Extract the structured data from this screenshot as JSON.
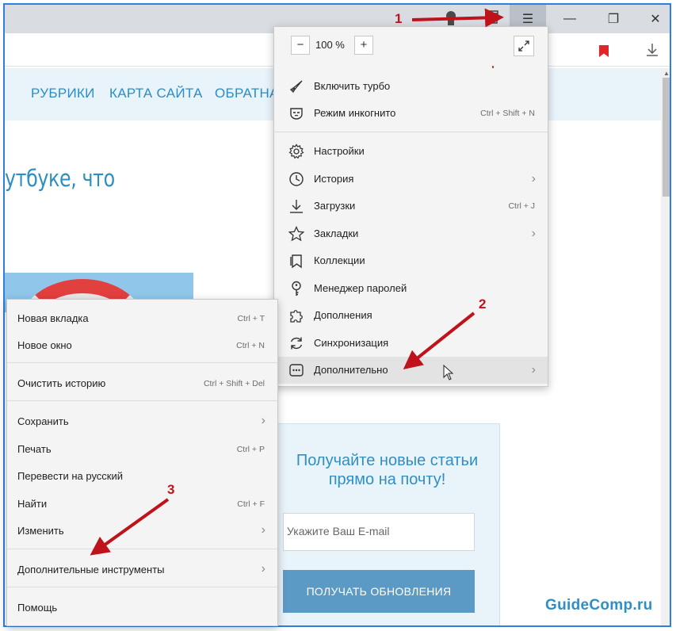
{
  "site": {
    "nav": [
      "РУБРИКИ",
      "КАРТА САЙТА",
      "ОБРАТНА"
    ],
    "headline": "утбуке, что",
    "subscribe": {
      "title": "Получайте новые статьи прямо на почту!",
      "email_placeholder": "Укажите Ваш E-mail",
      "button": "ПОЛУЧАТЬ ОБНОВЛЕНИЯ"
    }
  },
  "menu": {
    "zoom_minus": "−",
    "zoom_value": "100 %",
    "zoom_plus": "+",
    "items": [
      {
        "label": "Включить турбо",
        "icon": "rocket-icon"
      },
      {
        "label": "Режим инкогнито",
        "shortcut": "Ctrl + Shift + N",
        "icon": "incognito-mask-icon"
      },
      {
        "label": "Настройки",
        "icon": "gear-icon"
      },
      {
        "label": "История",
        "arrow": "›",
        "icon": "clock-icon"
      },
      {
        "label": "Загрузки",
        "shortcut": "Ctrl + J",
        "icon": "download-icon"
      },
      {
        "label": "Закладки",
        "arrow": "›",
        "icon": "star-icon"
      },
      {
        "label": "Коллекции",
        "icon": "collections-icon"
      },
      {
        "label": "Менеджер паролей",
        "icon": "key-icon"
      },
      {
        "label": "Дополнения",
        "icon": "puzzle-icon"
      },
      {
        "label": "Синхронизация",
        "icon": "sync-icon"
      },
      {
        "label": "Дополнительно",
        "arrow": "›",
        "icon": "more-dots-icon"
      }
    ]
  },
  "submenu": {
    "items": [
      {
        "label": "Новая вкладка",
        "shortcut": "Ctrl + T"
      },
      {
        "label": "Новое окно",
        "shortcut": "Ctrl + N"
      },
      {
        "label": "Очистить историю",
        "shortcut": "Ctrl + Shift + Del"
      },
      {
        "label": "Сохранить",
        "arrow": "›"
      },
      {
        "label": "Печать",
        "shortcut": "Ctrl + P"
      },
      {
        "label": "Перевести на русский"
      },
      {
        "label": "Найти",
        "shortcut": "Ctrl + F"
      },
      {
        "label": "Изменить",
        "arrow": "›"
      },
      {
        "label": "Дополнительные инструменты",
        "arrow": "›"
      },
      {
        "label": "Помощь"
      }
    ]
  },
  "annotations": {
    "one": "1",
    "two": "2",
    "three": "3"
  },
  "watermark": "GuideComp.ru",
  "colors": {
    "accent": "#2c8fc3",
    "annotation": "#c0121b",
    "frame": "#2f7fe0"
  }
}
